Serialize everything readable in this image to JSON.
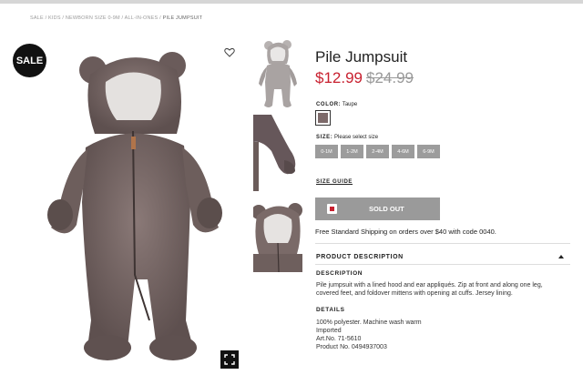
{
  "breadcrumb": {
    "path": "SALE / KIDS / NEWBORN SIZE 0-9M / ALL-IN-ONES / ",
    "current": "PILE JUMPSUIT"
  },
  "badge": "SALE",
  "product": {
    "title": "Pile Jumpsuit",
    "price_now": "$12.99",
    "price_was": "$24.99",
    "color_label": "COLOR:",
    "color_value": "Taupe",
    "color_swatch": "#7d6a6a",
    "size_label": "SIZE:",
    "size_prompt": "Please select size",
    "sizes": [
      "0-1M",
      "1-2M",
      "2-4M",
      "4-6M",
      "6-9M"
    ],
    "size_guide": "SIZE GUIDE",
    "sold_out": "SOLD OUT",
    "shipping": "Free Standard Shipping on orders over $40 with code 0040."
  },
  "description_section": {
    "header": "PRODUCT DESCRIPTION",
    "description_title": "DESCRIPTION",
    "description_line1": "Pile jumpsuit with a lined hood and ear appliqués. Zip at front and along one leg,",
    "description_line2": "covered feet, and foldover mittens with opening at cuffs. Jersey lining.",
    "details_title": "DETAILS",
    "details": [
      "100% polyester. Machine wash warm",
      "Imported",
      "Art.No. 71-5610",
      "Product No. 0494937003"
    ]
  },
  "colors": {
    "accent_price": "#c8202f",
    "button_gray": "#9a9a9a",
    "fabric": "#7a6a68"
  },
  "icons": {
    "favorite": "heart-outline-icon",
    "zoom": "expand-icon",
    "bag": "shopping-bag-icon",
    "toggle": "chevron-up-icon"
  }
}
